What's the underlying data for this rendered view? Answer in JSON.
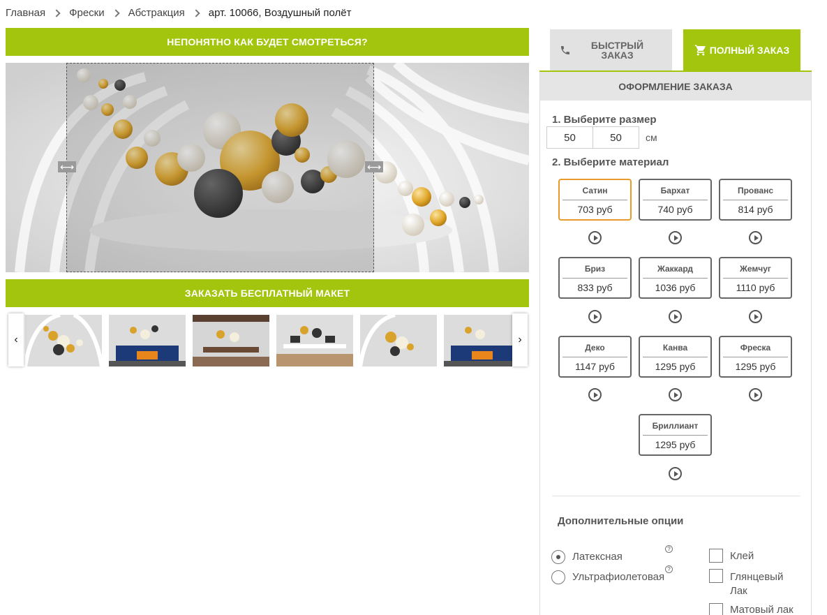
{
  "breadcrumb": {
    "items": [
      "Главная",
      "Фрески",
      "Абстракция"
    ],
    "current": "арт. 10066, Воздушный полёт"
  },
  "preview": {
    "top_button": "НЕПОНЯТНО КАК БУДЕТ СМОТРЕТЬСЯ?",
    "bottom_button": "ЗАКАЗАТЬ БЕСПЛАТНЫЙ МАКЕТ",
    "handle_glyph": "⟷"
  },
  "thumbnails": {
    "prev_glyph": "‹",
    "next_glyph": "›"
  },
  "tabs": {
    "quick_line1": "БЫСТРЫЙ",
    "quick_line2": "ЗАКАЗ",
    "full": "ПОЛНЫЙ ЗАКАЗ"
  },
  "order": {
    "title": "ОФОРМЛЕНИЕ ЗАКАЗА",
    "step1": "1. Выберите размер",
    "width": "50",
    "height": "50",
    "unit": "см",
    "step2": "2. Выберите материал",
    "materials": [
      {
        "name": "Сатин",
        "price": "703 руб"
      },
      {
        "name": "Бархат",
        "price": "740 руб"
      },
      {
        "name": "Прованс",
        "price": "814 руб"
      },
      {
        "name": "Бриз",
        "price": "833 руб"
      },
      {
        "name": "Жаккард",
        "price": "1036 руб"
      },
      {
        "name": "Жемчуг",
        "price": "1110 руб"
      },
      {
        "name": "Деко",
        "price": "1147 руб"
      },
      {
        "name": "Канва",
        "price": "1295 руб"
      },
      {
        "name": "Фреска",
        "price": "1295 руб"
      },
      {
        "name": "Бриллиант",
        "price": "1295 руб"
      }
    ],
    "extra_title": "Дополнительные опции",
    "coating": {
      "latex": "Латексная",
      "uv": "Ультрафиолетовая"
    },
    "help_glyph": "?",
    "addons": {
      "glue": "Клей",
      "gloss_line1": "Глянцевый",
      "gloss_line2": "Лак",
      "matte": "Матовый лак"
    }
  },
  "colors": {
    "accent": "#a3c50d",
    "selected_border": "#e89a2c"
  }
}
